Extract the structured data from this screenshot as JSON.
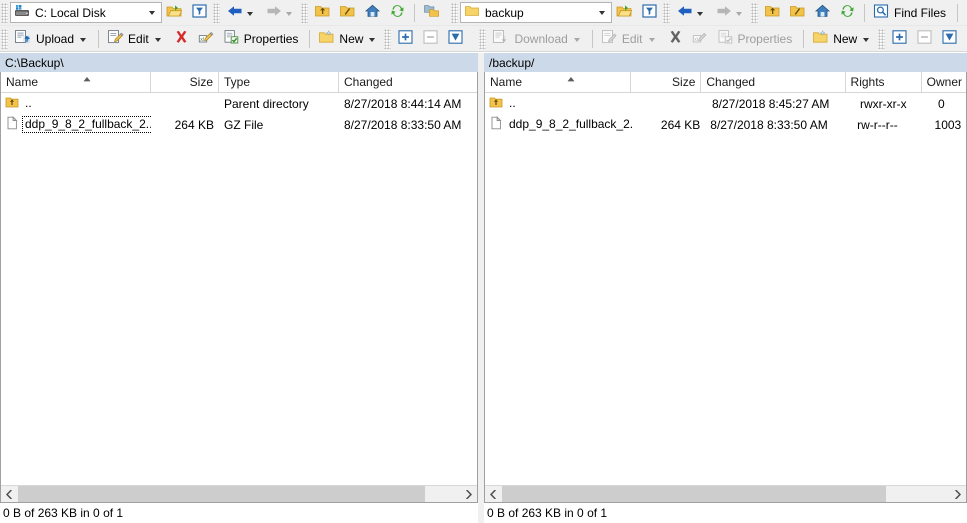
{
  "toolbars": {
    "left": {
      "drive_combo": {
        "value": "C: Local Disk",
        "icon": "hard-drive-icon"
      },
      "open_dir_icon": "open-folder-icon",
      "filter_icon": "filter-funnel-icon",
      "back_icon": "back-arrow-icon",
      "forward_icon": "forward-arrow-icon",
      "parent_icon": "parent-directory-icon",
      "root_icon": "root-directory-icon",
      "home_icon": "home-icon",
      "refresh_icon": "refresh-icon",
      "sync_browsing_icon": "synchronize-browsing-icon",
      "upload_label": "Upload",
      "upload_icon": "upload-icon",
      "edit_label": "Edit",
      "edit_icon": "edit-pencil-icon",
      "delete_icon": "delete-x-icon",
      "rename_icon": "rename-icon",
      "properties_label": "Properties",
      "properties_icon": "properties-icon",
      "new_label": "New",
      "new_icon": "new-folder-icon",
      "select_icon": "select-plus-icon",
      "unselect_icon": "unselect-minus-icon",
      "invert_icon": "invert-selection-icon"
    },
    "right": {
      "remote_combo": {
        "value": "backup",
        "icon": "folder-icon"
      },
      "open_dir_icon": "open-folder-icon",
      "filter_icon": "filter-funnel-icon",
      "back_icon": "back-arrow-icon",
      "forward_icon": "forward-arrow-icon",
      "parent_icon": "parent-directory-icon",
      "root_icon": "root-directory-icon",
      "home_icon": "home-icon",
      "refresh_icon": "refresh-icon",
      "find_files_label": "Find Files",
      "find_files_icon": "find-files-icon",
      "sync_browsing_icon": "synchronize-browsing-icon",
      "download_label": "Download",
      "download_icon": "download-icon",
      "edit_label": "Edit",
      "edit_icon": "edit-pencil-icon",
      "delete_icon": "delete-x-icon",
      "rename_icon": "rename-icon",
      "properties_label": "Properties",
      "properties_icon": "properties-icon",
      "new_label": "New",
      "new_icon": "new-folder-icon",
      "select_icon": "select-plus-icon",
      "unselect_icon": "unselect-minus-icon",
      "invert_icon": "invert-selection-icon"
    }
  },
  "left_panel": {
    "path": "C:\\Backup\\",
    "columns": [
      "Name",
      "Size",
      "Type",
      "Changed"
    ],
    "sorted_column": "Name",
    "sort_direction": "ascending",
    "rows": [
      {
        "name": "..",
        "size": "",
        "type": "Parent directory",
        "changed": "8/27/2018  8:44:14 AM",
        "icon": "parent-directory-icon",
        "focused": false
      },
      {
        "name": "ddp_9_8_2_fullback_2...",
        "size": "264 KB",
        "type": "GZ File",
        "changed": "8/27/2018  8:33:50 AM",
        "icon": "file-icon",
        "focused": true
      }
    ],
    "status": "0 B of 263 KB in 0 of 1"
  },
  "right_panel": {
    "path": "/backup/",
    "columns": [
      "Name",
      "Size",
      "Changed",
      "Rights",
      "Owner"
    ],
    "sorted_column": "Name",
    "sort_direction": "ascending",
    "rows": [
      {
        "name": "..",
        "size": "",
        "changed": "8/27/2018 8:45:27 AM",
        "rights": "rwxr-xr-x",
        "owner": "0",
        "icon": "parent-directory-icon",
        "focused": false
      },
      {
        "name": "ddp_9_8_2_fullback_2...",
        "size": "264 KB",
        "changed": "8/27/2018 8:33:50 AM",
        "rights": "rw-r--r--",
        "owner": "1003",
        "icon": "file-icon",
        "focused": false
      }
    ],
    "status": "0 B of 263 KB in 0 of 1"
  },
  "colors": {
    "pathbar_bg": "#ccd9e8",
    "toolbar_bg": "#f0f0f0",
    "folder_yellow": "#f6c445",
    "delete_red": "#d42b2b",
    "arrow_blue": "#1f5fbf",
    "refresh_green": "#3ea832",
    "disabled_grey": "#9d9d9d"
  }
}
